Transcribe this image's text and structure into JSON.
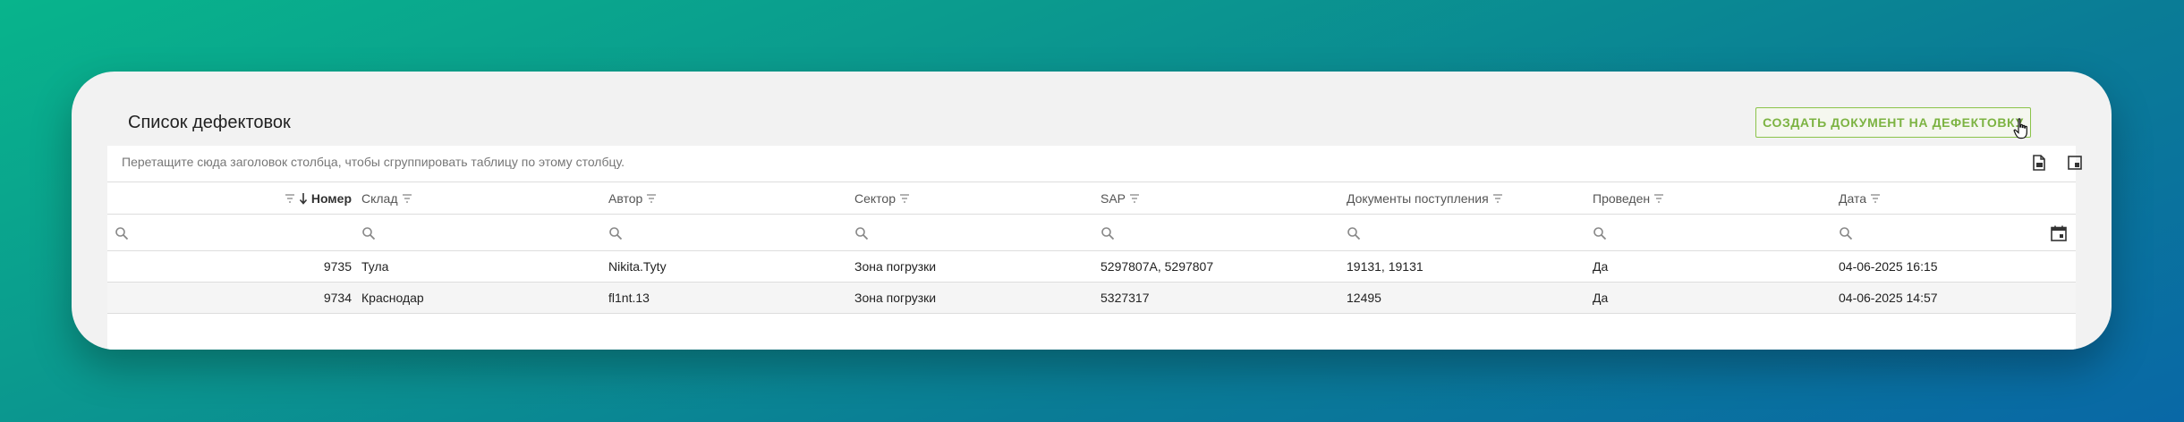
{
  "page": {
    "title": "Список дефектовок",
    "create_button_label": "СОЗДАТЬ ДОКУМЕНТ НА ДЕФЕКТОВКУ"
  },
  "grid": {
    "group_hint": "Перетащите сюда заголовок столбца, чтобы сгруппировать таблицу по этому столбцу.",
    "columns": [
      "Номер",
      "Склад",
      "Автор",
      "Сектор",
      "SAP",
      "Документы поступления",
      "Проведен",
      "Дата"
    ],
    "sort": {
      "column": "Номер",
      "direction": "desc"
    },
    "rows": [
      [
        "9735",
        "Тула",
        "Nikita.Tyty",
        "Зона погрузки",
        "5297807A, 5297807",
        "19131, 19131",
        "Да",
        "04-06-2025 16:15"
      ],
      [
        "9734",
        "Краснодар",
        "fl1nt.13",
        "Зона погрузки",
        "5327317",
        "12495",
        "Да",
        "04-06-2025 14:57"
      ]
    ]
  },
  "icons": {
    "export": "export-file-icon",
    "column_chooser": "column-chooser-icon",
    "search": "search-icon",
    "calendar": "calendar-icon",
    "filter": "filter-icon",
    "sort": "sort-desc-arrow-icon",
    "cursor": "hand-pointer-icon"
  },
  "colors": {
    "accent": "#8bc34a",
    "accent_text": "#7cb342",
    "card_bg": "#f2f2f2"
  }
}
